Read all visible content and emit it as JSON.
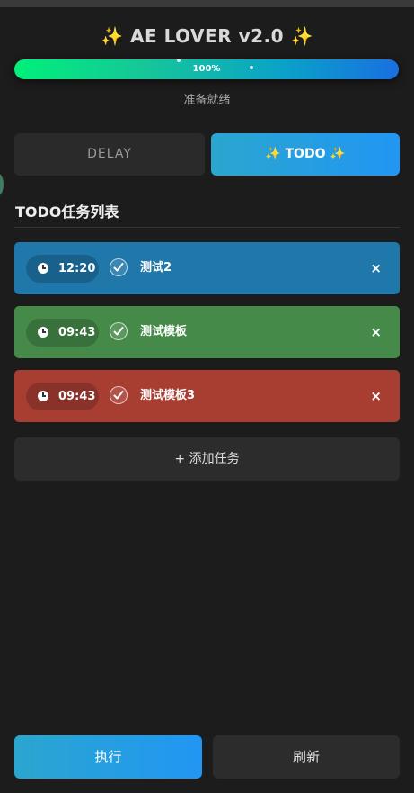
{
  "header": {
    "title": "✨ AE LOVER v2.0 ✨",
    "progress_value": 1.0,
    "progress_label": "100%",
    "status": "准备就绪"
  },
  "tabs": [
    {
      "label": "DELAY",
      "active": false
    },
    {
      "label": "✨ TODO ✨",
      "active": true
    }
  ],
  "todo": {
    "section_title": "TODO任务列表",
    "tasks": [
      {
        "time": "12:20",
        "name": "测试2",
        "color": "#1f77aa",
        "checked": true,
        "clock_icon": "clock-icon",
        "close": "×"
      },
      {
        "time": "09:43",
        "name": "测试模板",
        "color": "#458a48",
        "checked": true,
        "clock_icon": "clock-icon",
        "close": "×"
      },
      {
        "time": "09:43",
        "name": "测试模板3",
        "color": "#a83d32",
        "checked": true,
        "clock_icon": "clock-icon",
        "close": "×"
      }
    ],
    "add_label": "+ 添加任务"
  },
  "footer": {
    "execute_label": "执行",
    "refresh_label": "刷新"
  },
  "colors": {
    "background": "#1c1c1c",
    "accent_gradient_start": "#2aa6cf",
    "accent_gradient_end": "#2196f3"
  }
}
